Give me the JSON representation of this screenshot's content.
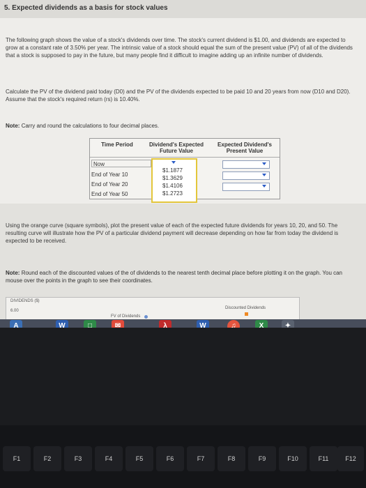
{
  "page": {
    "title": "5. Expected dividends as a basis for stock values",
    "intro": "The following graph shows the value of a stock's dividends over time. The stock's current dividend is $1.00, and dividends are expected to grow at a constant rate of 3.50% per year. The intrinsic value of a stock should equal the sum of the present value (PV) of all of the dividends that a stock is supposed to pay in the future, but many people find it difficult to imagine adding up an infinite number of dividends.",
    "question": "Calculate the PV of the dividend paid today (D0) and the PV of the dividends expected to be paid 10 and 20 years from now (D10 and D20). Assume that the stock's required return (rs) is 10.40%.",
    "note1_label": "Note:",
    "note1_text": "Carry and round the calculations to four decimal places.",
    "instructions": "Using the orange curve (square symbols), plot the present value of each of the expected future dividends for years 10, 20, and 50. The resulting curve will illustrate how the PV of a particular dividend payment will decrease depending on how far from today the dividend is expected to be received.",
    "note2_label": "Note:",
    "note2_text": "Round each of the discounted values of the of dividends to the nearest tenth decimal place before plotting it on the graph. You can mouse over the points in the graph to see their coordinates."
  },
  "table": {
    "col_time": "Time Period",
    "col_fv": "Dividend's Expected Future Value",
    "col_pv": "Expected Dividend's Present Value",
    "rows": [
      "Now",
      "End of Year 10",
      "End of Year 20",
      "End of Year 50"
    ],
    "dropdown_options": [
      "$1.1877",
      "$1.3629",
      "$1.4106",
      "$1.2723"
    ]
  },
  "chart": {
    "ylabel": "DIVIDENDS ($)",
    "ytick": "6.00",
    "legend_fv": "FV of Dividends",
    "legend_pv": "Discounted Dividends"
  },
  "taskbar": {
    "apps": [
      "A",
      "W",
      "W"
    ]
  },
  "keyboard": {
    "keys": [
      "F1",
      "F2",
      "F3",
      "F4",
      "F5",
      "F6",
      "F7",
      "F8",
      "F9",
      "F10",
      "F11",
      "F12"
    ]
  },
  "colors": {
    "accent": "#2b5cc6",
    "highlight": "#e3c63b",
    "orange": "#f08a24"
  }
}
